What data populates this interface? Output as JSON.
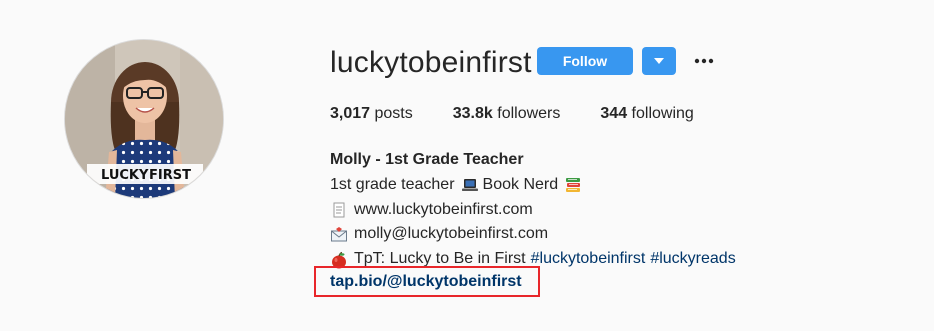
{
  "profile": {
    "username": "luckytobeinfirst",
    "follow_label": "Follow",
    "avatar_watermark_left": "LUCKY",
    "avatar_watermark_right": "FIRST"
  },
  "stats": {
    "posts_count": "3,017",
    "posts_label": "posts",
    "followers_count": "33.8k",
    "followers_label": "followers",
    "following_count": "344",
    "following_label": "following"
  },
  "bio": {
    "full_name": "Molly - 1st Grade Teacher",
    "line1_text": "1st grade teacher",
    "line1_text2": "Book Nerd",
    "website": "www.luckytobeinfirst.com",
    "email": "molly@luckytobeinfirst.com",
    "tpt_text": "TpT: Lucky to Be in First",
    "hashtag1": "#luckytobeinfirst",
    "hashtag2": "#luckyreads",
    "link": "tap.bio/@luckytobeinfirst"
  },
  "icons": {
    "dropdown": "chevron-down-icon",
    "more": "ellipsis-icon",
    "laptop": "laptop-icon",
    "books": "books-icon",
    "page": "page-icon",
    "envelope": "envelope-icon",
    "apple": "apple-icon"
  },
  "colors": {
    "button_blue": "#3897f0",
    "link_blue": "#003569",
    "highlight_red": "#e8262a"
  }
}
